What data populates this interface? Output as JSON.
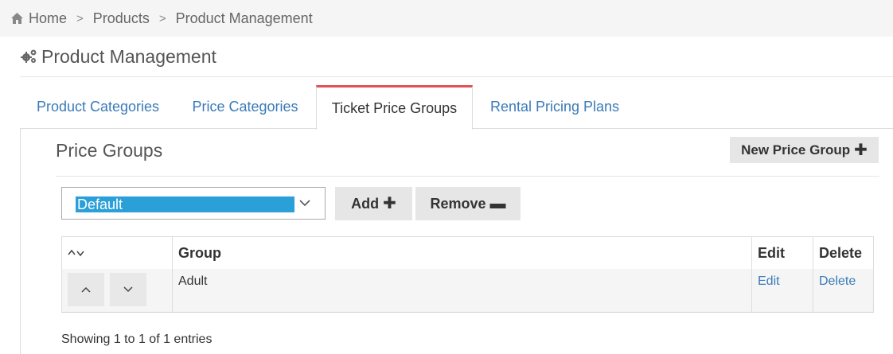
{
  "breadcrumb": {
    "home": "Home",
    "products": "Products",
    "current": "Product Management",
    "separator": ">"
  },
  "page": {
    "title": "Product Management",
    "title_icon": "gears-icon"
  },
  "tabs": [
    {
      "label": "Product Categories",
      "active": false
    },
    {
      "label": "Price Categories",
      "active": false
    },
    {
      "label": "Ticket Price Groups",
      "active": true
    },
    {
      "label": "Rental Pricing Plans",
      "active": false
    }
  ],
  "section": {
    "title": "Price Groups",
    "new_button": "New Price Group",
    "new_button_icon": "plus-icon"
  },
  "selector": {
    "value": "Default",
    "add_button": "Add",
    "add_icon": "plus-icon",
    "remove_button": "Remove",
    "remove_icon": "minus-icon"
  },
  "table": {
    "columns": {
      "sort": "sort-arrows-icon",
      "group": "Group",
      "edit": "Edit",
      "delete": "Delete"
    },
    "rows": [
      {
        "group": "Adult",
        "edit": "Edit",
        "delete": "Delete"
      }
    ]
  },
  "info": "Showing 1 to 1 of 1 entries",
  "colors": {
    "link": "#3a7ab8",
    "active_tab_border": "#e05257",
    "selection": "#2a9fd8",
    "button_bg": "#e6e6e6"
  }
}
